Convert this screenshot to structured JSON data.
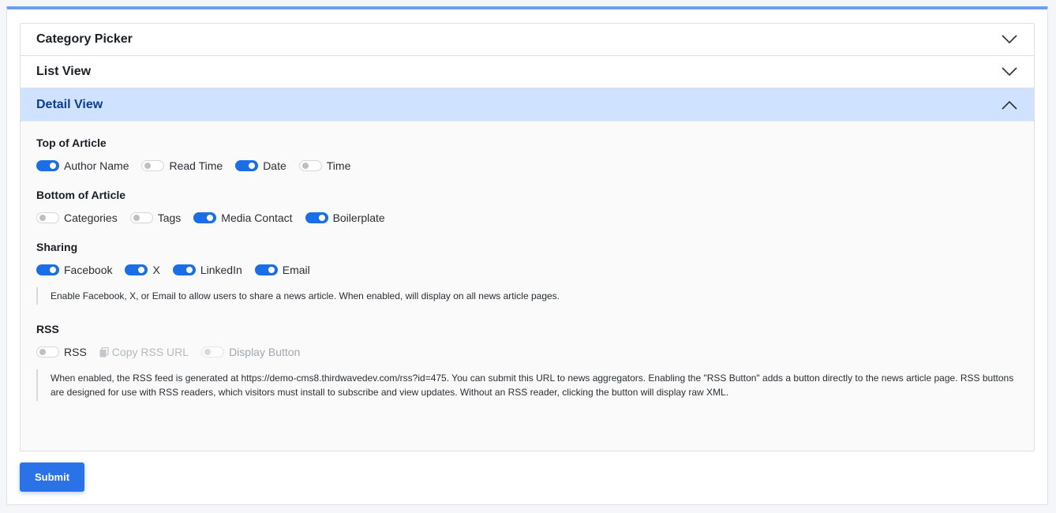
{
  "accordion": {
    "category_picker": {
      "title": "Category Picker"
    },
    "list_view": {
      "title": "List View"
    },
    "detail_view": {
      "title": "Detail View",
      "top": {
        "title": "Top of Article",
        "items": [
          {
            "label": "Author Name",
            "on": true
          },
          {
            "label": "Read Time",
            "on": false
          },
          {
            "label": "Date",
            "on": true
          },
          {
            "label": "Time",
            "on": false
          }
        ]
      },
      "bottom": {
        "title": "Bottom of Article",
        "items": [
          {
            "label": "Categories",
            "on": false
          },
          {
            "label": "Tags",
            "on": false
          },
          {
            "label": "Media Contact",
            "on": true
          },
          {
            "label": "Boilerplate",
            "on": true
          }
        ]
      },
      "sharing": {
        "title": "Sharing",
        "items": [
          {
            "label": "Facebook",
            "on": true
          },
          {
            "label": "X",
            "on": true
          },
          {
            "label": "LinkedIn",
            "on": true
          },
          {
            "label": "Email",
            "on": true
          }
        ],
        "note": "Enable Facebook, X, or Email to allow users to share a news article. When enabled, will display on all news article pages."
      },
      "rss": {
        "title": "RSS",
        "rss_label": "RSS",
        "copy_label": "Copy RSS URL",
        "display_label": "Display Button",
        "note": "When enabled, the RSS feed is generated at https://demo-cms8.thirdwavedev.com/rss?id=475. You can submit this URL to news aggregators. Enabling the \"RSS Button\" adds a button directly to the news article page. RSS buttons are designed for use with RSS readers, which visitors must install to subscribe and view updates. Without an RSS reader, clicking the button will display raw XML."
      }
    }
  },
  "submit_label": "Submit",
  "colors": {
    "accent": "#1a6ee6",
    "open_header": "#cfe2ff",
    "top_bar": "#6c9ef5"
  },
  "icons": [
    "chevron-down-icon",
    "chevron-up-icon",
    "copy-icon"
  ]
}
